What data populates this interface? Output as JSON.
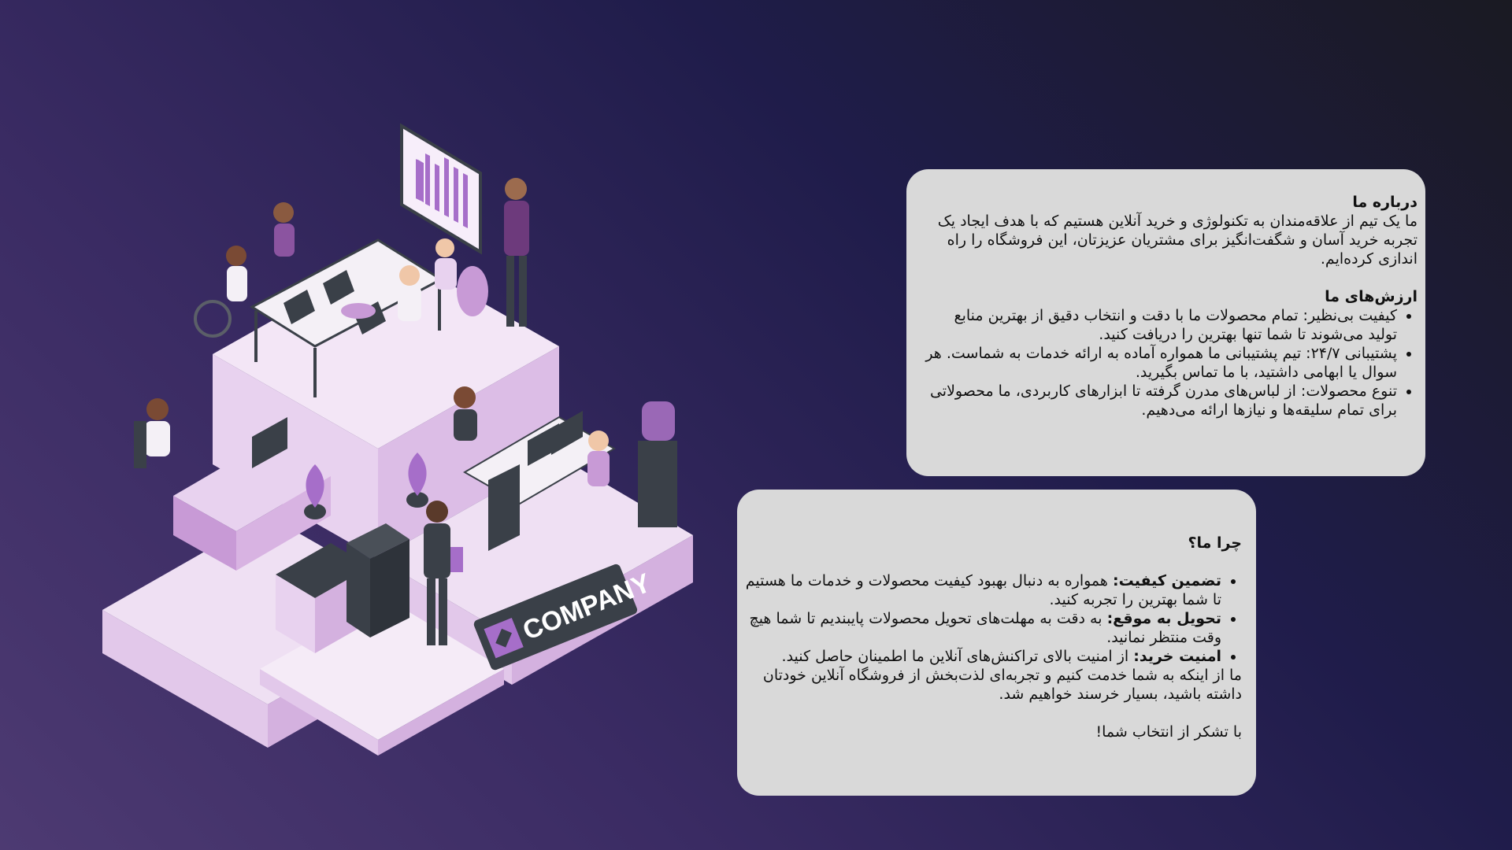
{
  "colors": {
    "background_start": "#4d3a72",
    "background_mid": "#1f1c4a",
    "background_end": "#1a1a22",
    "card": "#d9d9d9",
    "accent_purple": "#a66ec9",
    "light_purple": "#e8d2ef",
    "dark_slate": "#3a4048"
  },
  "illustration": {
    "sign_text": "COMPANY"
  },
  "about": {
    "title": "درباره ما",
    "body": "ما یک تیم از علاقه‌مندان به تکنولوژی و خرید آنلاین هستیم که با هدف ایجاد یک تجربه خرید آسان و شگفت‌انگیز  برای مشتریان عزیزتان، این فروشگاه را راه اندازی کرده‌ایم.",
    "values_title": "ارزش‌های ما",
    "values": [
      "کیفیت بی‌نظیر: تمام محصولات ما با دقت و انتخاب دقیق از بهترین منابع تولید می‌شوند تا شما تنها بهترین را دریافت کنید.",
      "پشتیبانی ۲۴/۷: تیم پشتیبانی ما همواره آماده به ارائه خدمات به شماست. هر سوال یا ابهامی داشتید، با ما تماس بگیرید.",
      "تنوع محصولات: از لباس‌های مدرن گرفته تا ابزارهای کاربردی، ما محصولاتی برای تمام سلیقه‌ها و نیازها ارائه می‌دهیم."
    ]
  },
  "why": {
    "title": "چرا ما؟",
    "items": [
      {
        "label": "تضمین کیفیت:",
        "text": " همواره به دنبال بهبود کیفیت محصولات و خدمات ما هستیم تا شما بهترین را تجربه کنید."
      },
      {
        "label": "تحویل به موقع:",
        "text": " به دقت به مهلت‌های تحویل محصولات پایبندیم تا شما هیچ وقت منتظر نمانید."
      },
      {
        "label": "امنیت خرید:",
        "text": " از امنیت بالای تراکنش‌های آنلاین ما اطمینان حاصل کنید."
      }
    ],
    "closing": "ما از اینکه به شما خدمت کنیم و تجربه‌ای لذت‌بخش از فروشگاه آنلاین خودتان داشته باشید، بسیار خرسند خواهیم شد.",
    "thanks": "با تشکر از انتخاب شما!"
  }
}
